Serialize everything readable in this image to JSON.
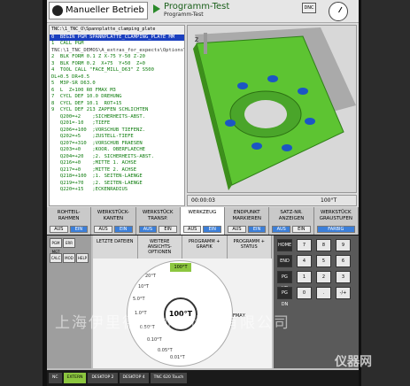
{
  "header": {
    "mode_label": "Manueller Betrieb",
    "program_title": "Programm-Test",
    "program_subtitle": "Programm-Test",
    "dnc_label": "DNC"
  },
  "nc_program": {
    "path": "TNC:\\1_TNC_O\\Spannplatte_clamping_plate",
    "lines": [
      "0  BEGIN PGM SPANNPLATTE_CLAMPING_PLATE MM",
      "1  CALL PGM",
      "TNC:\\1_TNC_DEMOS\\A_extras_for_expects\\Options\\zeset.H",
      "2  BLK FORM 0.1 Z X-75 Y-50 Z-20",
      "3  BLK FORM 0.2  X+75  Y+50  Z+0",
      "4  TOOL CALL \"FACE_MILL_D63\" Z S500",
      "DL+0.5 DR+0.5",
      "5  M3P-SR D63.0",
      "6  L  Z+100 R0 FMAX M3",
      "7  CYCL DEF 10.0 DREHUNG",
      "8  CYCL DEF 10.1  ROT+15",
      "9  CYCL DEF 213 ZAPFEN SCHLICHTEN",
      "   Q200=+2    ;SICHERHEITS-ABST.",
      "   Q201=-10   ;TIEFE",
      "   Q206=+100  ;VORSCHUB TIEFENZ.",
      "   Q202=+5    ;ZUSTELL-TIEFE",
      "   Q207=+310  ;VORSCHUB FRAESEN",
      "   Q203=+0    ;KOOR. OBERFLAECHE",
      "   Q204=+20   ;2. SICHERHEITS-ABST.",
      "   Q216=+0    ;MITTE 1. ACHSE",
      "   Q217=+0    ;MITTE 2. ACHSE",
      "   Q218=+100  ;1. SEITEN-LAENGE",
      "   Q219=+70   ;2. SEITEN-LAENGE",
      "   Q220=+15   ;ECKENRADIUS"
    ]
  },
  "sim_bar": {
    "time": "00:00:03",
    "override": "100°T"
  },
  "softkeys": [
    {
      "label": "ROHTEIL-\nRAHMEN",
      "toggle": [
        "AUS",
        "EIN"
      ],
      "on": 1
    },
    {
      "label": "WERKSTÜCK-\nKANTEN",
      "toggle": [
        "AUS",
        "EIN"
      ],
      "on": 1
    },
    {
      "label": "WERKSTÜCK\nTRANSP.",
      "toggle": [
        "AUS",
        "EIN"
      ],
      "on": 0
    },
    {
      "label": "WERKZEUG",
      "toggle": [
        "AUS",
        "EIN"
      ],
      "on": 1
    },
    {
      "label": "ENDPUNKT\nMARKIEREN",
      "toggle": [
        "AUS",
        "EIN"
      ],
      "on": 1
    },
    {
      "label": "SATZ-NR.\nANZEIGEN",
      "toggle": [
        "AUS",
        "EIN"
      ],
      "on": 0
    },
    {
      "label": "WERKSTÜCK\nGRAUSTUFEN",
      "toggle": [
        "FARBIG"
      ],
      "on": 0
    }
  ],
  "lower": {
    "left_keys": [
      "PGM MGT",
      "ERR",
      "CALC",
      "MOD",
      "HELP"
    ],
    "mid_tabs": [
      "LETZTE\nDATEIEN",
      "WEITERE\nANSICHTS-\nOPTIONEN",
      "PROGRAMM\n+\nGRAFIK",
      "PROGRAMM\n+\nSTATUS"
    ],
    "dial_value": "100°T",
    "dial_top": "100°T",
    "fmax": "FMAX",
    "dial_labels": [
      "20°T",
      "10°T",
      "5.0°T",
      "1.0°T",
      "0.50°T",
      "0.10°T",
      "0.05°T",
      "0.01°T"
    ],
    "right_keys": [
      "HOME",
      "7",
      "8",
      "9",
      "END",
      "4",
      "5",
      "6",
      "PG UP",
      "1",
      "2",
      "3",
      "PG DN",
      "0",
      ".",
      "-/+"
    ],
    "taskbar": [
      "NC",
      "EXTERN",
      "DESKTOP 2",
      "DESKTOP 4",
      "TNC 620 Touch"
    ]
  },
  "watermark": "上海伊里德自动化设备有限公司",
  "watermark_site": "仪器网"
}
